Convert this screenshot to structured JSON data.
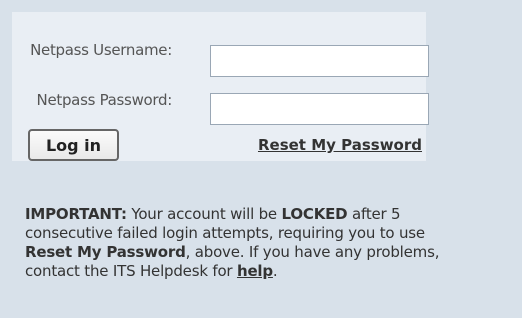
{
  "login": {
    "username_label": "Netpass Username:",
    "username_value": "",
    "password_label": "Netpass Password:",
    "password_value": "",
    "login_button": "Log in",
    "reset_link": "Reset My Password"
  },
  "notice": {
    "line1_strong": "IMPORTANT:",
    "line1_text": " Your account will be ",
    "line1_locked": "LOCKED",
    "line1_tail": " after 5",
    "line2_text": "consecutive failed login attempts, requiring you to use",
    "line3_strong": "Reset My Password",
    "line3_text": ", above. If you have any problems,",
    "line4_text": "contact the ITS Helpdesk for ",
    "line4_link": "help",
    "line4_tail": "."
  },
  "colors": {
    "page_background": "#d8e1ea",
    "panel_background": "#e9eef4",
    "text": "#333333",
    "input_border": "#9aa7b5"
  }
}
